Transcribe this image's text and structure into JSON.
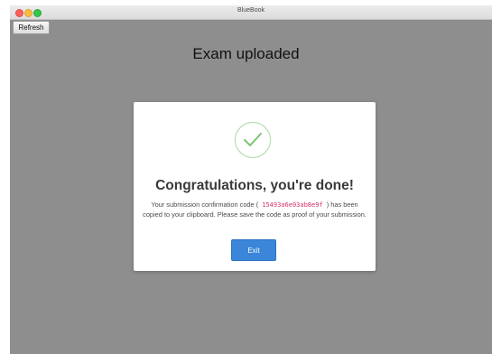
{
  "window": {
    "title": "BlueBook"
  },
  "toolbar": {
    "refresh_label": "Refresh"
  },
  "main": {
    "heading": "Exam uploaded"
  },
  "dialog": {
    "title": "Congratulations, you're done!",
    "message_before_code": "Your submission confirmation code (",
    "code": "15493a6e03ab8e9f",
    "message_after_code": ") has been copied to your clipboard. Please save the code as proof of your submission.",
    "exit_label": "Exit",
    "icon": "checkmark-circle-icon"
  },
  "colors": {
    "backdrop": "#8e8e8e",
    "accent": "#3b86d9",
    "check": "#7cc472",
    "code": "#d6306b"
  }
}
